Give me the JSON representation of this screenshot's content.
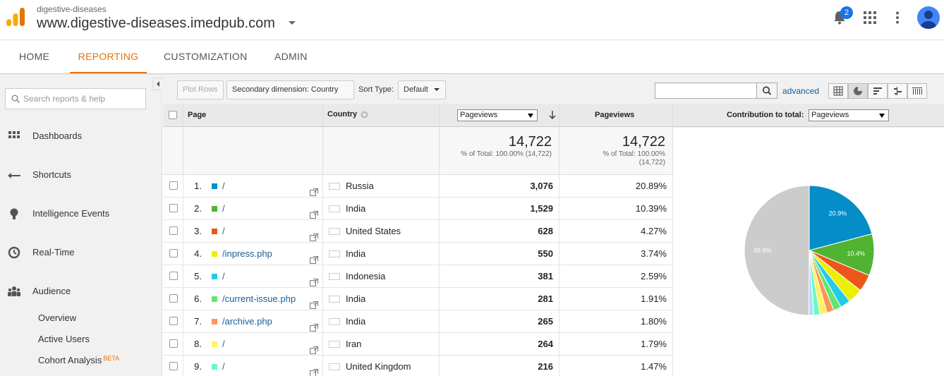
{
  "header": {
    "account_small": "digestive-diseases",
    "account_title": "www.digestive-diseases.imedpub.com",
    "notifications_count": "2"
  },
  "nav": {
    "tabs": [
      {
        "label": "HOME",
        "active": false
      },
      {
        "label": "REPORTING",
        "active": true
      },
      {
        "label": "CUSTOMIZATION",
        "active": false
      },
      {
        "label": "ADMIN",
        "active": false
      }
    ]
  },
  "sidebar": {
    "search_placeholder": "Search reports & help",
    "items": [
      {
        "label": "Dashboards",
        "icon": "grid-icon"
      },
      {
        "label": "Shortcuts",
        "icon": "shortcut-arrow-icon"
      },
      {
        "label": "Intelligence Events",
        "icon": "lightbulb-icon"
      },
      {
        "label": "Real-Time",
        "icon": "clock-icon"
      },
      {
        "label": "Audience",
        "icon": "people-icon"
      }
    ],
    "subitems": [
      {
        "label": "Overview"
      },
      {
        "label": "Active Users"
      },
      {
        "label": "Cohort Analysis",
        "badge": "BETA"
      }
    ]
  },
  "toolbar": {
    "plot_rows": "Plot Rows",
    "secondary_dimension": "Secondary dimension: Country",
    "sort_type_label": "Sort Type:",
    "sort_type_value": "Default",
    "advanced": "advanced"
  },
  "table": {
    "headers": {
      "page": "Page",
      "country": "Country",
      "metric_select": "Pageviews",
      "pageviews": "Pageviews",
      "contribution_label": "Contribution to total:",
      "contribution_select": "Pageviews"
    },
    "totals": {
      "value1": "14,722",
      "sub1": "% of Total: 100.00% (14,722)",
      "value2": "14,722",
      "sub2a": "% of Total: 100.00%",
      "sub2b": "(14,722)"
    },
    "rows": [
      {
        "num": "1.",
        "page": "/",
        "color": "#058dc7",
        "country": "Russia",
        "flag": "russia",
        "pageviews": "3,076",
        "percent": "20.89%"
      },
      {
        "num": "2.",
        "page": "/",
        "color": "#50b432",
        "country": "India",
        "flag": "india",
        "pageviews": "1,529",
        "percent": "10.39%"
      },
      {
        "num": "3.",
        "page": "/",
        "color": "#ed561b",
        "country": "United States",
        "flag": "usa",
        "pageviews": "628",
        "percent": "4.27%"
      },
      {
        "num": "4.",
        "page": "/inpress.php",
        "color": "#edef00",
        "country": "India",
        "flag": "india",
        "pageviews": "550",
        "percent": "3.74%"
      },
      {
        "num": "5.",
        "page": "/",
        "color": "#24cbe5",
        "country": "Indonesia",
        "flag": "indonesia",
        "pageviews": "381",
        "percent": "2.59%"
      },
      {
        "num": "6.",
        "page": "/current-issue.php",
        "color": "#64e572",
        "country": "India",
        "flag": "india",
        "pageviews": "281",
        "percent": "1.91%"
      },
      {
        "num": "7.",
        "page": "/archive.php",
        "color": "#ff9655",
        "country": "India",
        "flag": "india",
        "pageviews": "265",
        "percent": "1.80%"
      },
      {
        "num": "8.",
        "page": "/",
        "color": "#fff263",
        "country": "Iran",
        "flag": "iran",
        "pageviews": "264",
        "percent": "1.79%"
      },
      {
        "num": "9.",
        "page": "/",
        "color": "#6af9c4",
        "country": "United Kingdom",
        "flag": "uk",
        "pageviews": "216",
        "percent": "1.47%"
      }
    ]
  },
  "pie": {
    "slices": [
      {
        "value": 20.89,
        "color": "#058dc7",
        "label": "20.9%"
      },
      {
        "value": 10.39,
        "color": "#50b432",
        "label": "10.4%"
      },
      {
        "value": 4.27,
        "color": "#ed561b"
      },
      {
        "value": 3.74,
        "color": "#edef00"
      },
      {
        "value": 2.59,
        "color": "#24cbe5"
      },
      {
        "value": 1.91,
        "color": "#64e572"
      },
      {
        "value": 1.8,
        "color": "#ff9655"
      },
      {
        "value": 1.79,
        "color": "#fff263"
      },
      {
        "value": 1.47,
        "color": "#6af9c4"
      },
      {
        "value": 1.25,
        "color": "#b2deff"
      },
      {
        "value": 49.9,
        "color": "#cccccc",
        "label": "49.9%"
      }
    ]
  }
}
